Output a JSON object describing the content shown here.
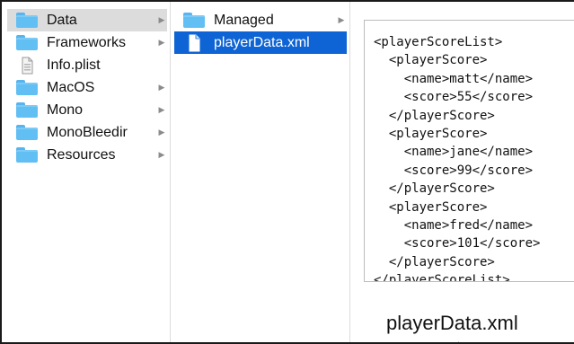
{
  "column1": {
    "items": [
      {
        "label": "Data",
        "icon": "folder-icon",
        "selected": "gray",
        "has_children": true
      },
      {
        "label": "Frameworks",
        "icon": "folder-icon",
        "selected": "none",
        "has_children": true
      },
      {
        "label": "Info.plist",
        "icon": "plist-file-icon",
        "selected": "none",
        "has_children": false
      },
      {
        "label": "MacOS",
        "icon": "folder-icon",
        "selected": "none",
        "has_children": true
      },
      {
        "label": "Mono",
        "icon": "folder-icon",
        "selected": "none",
        "has_children": true
      },
      {
        "label": "MonoBleedir",
        "icon": "folder-icon",
        "selected": "none",
        "has_children": true
      },
      {
        "label": "Resources",
        "icon": "folder-icon",
        "selected": "none",
        "has_children": true
      }
    ]
  },
  "column2": {
    "items": [
      {
        "label": "Managed",
        "icon": "folder-icon",
        "selected": "none",
        "has_children": true
      },
      {
        "label": "playerData.xml",
        "icon": "document-icon",
        "selected": "blue",
        "has_children": false
      }
    ]
  },
  "preview": {
    "content": "<playerScoreList>\n  <playerScore>\n    <name>matt</name>\n    <score>55</score>\n  </playerScore>\n  <playerScore>\n    <name>jane</name>\n    <score>99</score>\n  </playerScore>\n  <playerScore>\n    <name>fred</name>\n    <score>101</score>\n  </playerScore>\n</playerScoreList>",
    "file_name": "playerData.xml"
  },
  "colors": {
    "selection_blue": "#0e64d4",
    "selection_gray": "#dcdcdc",
    "folder_blue": "#62bff3"
  }
}
